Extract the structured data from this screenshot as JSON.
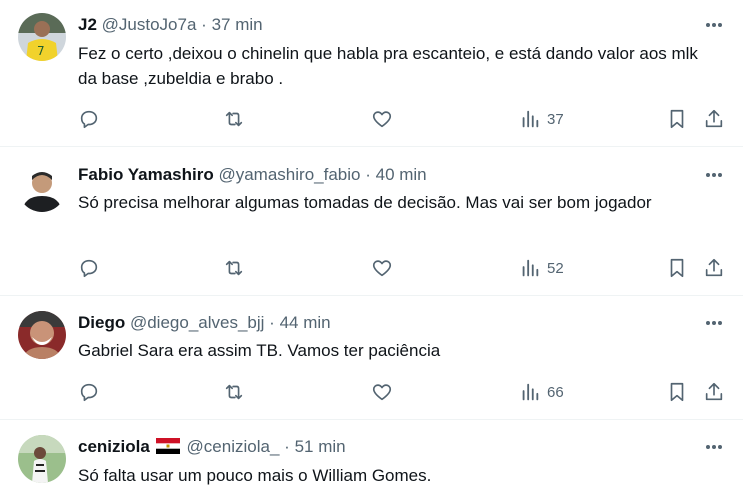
{
  "tweets": [
    {
      "name": "J2",
      "handle": "@JustoJo7a",
      "separator": "·",
      "time": "37 min",
      "text": "Fez o certo ,deixou o chinelin que habla pra escanteio, e está dando valor aos mlk da base ,zubeldia e brabo .",
      "views": "37"
    },
    {
      "name": "Fabio Yamashiro",
      "handle": "@yamashiro_fabio",
      "separator": "·",
      "time": "40 min",
      "text": "Só precisa melhorar algumas tomadas de decisão.  Mas vai ser bom jogador",
      "views": "52"
    },
    {
      "name": "Diego",
      "handle": "@diego_alves_bjj",
      "separator": "·",
      "time": "44 min",
      "text": "Gabriel Sara era assim TB. Vamos ter paciência",
      "views": "66"
    },
    {
      "name": "ceniziola",
      "handle": "@ceniziola_",
      "separator": "·",
      "time": "51 min",
      "text": "Só falta usar um pouco mais o William Gomes.",
      "views": ""
    }
  ],
  "icons": {
    "reply": "reply-icon",
    "retweet": "retweet-icon",
    "like": "heart-icon",
    "views": "views-chart-icon",
    "bookmark": "bookmark-icon",
    "share": "share-icon",
    "more": "more-icon"
  },
  "colors": {
    "text": "#0f1419",
    "secondary": "#536471",
    "divider": "#eff3f4"
  }
}
